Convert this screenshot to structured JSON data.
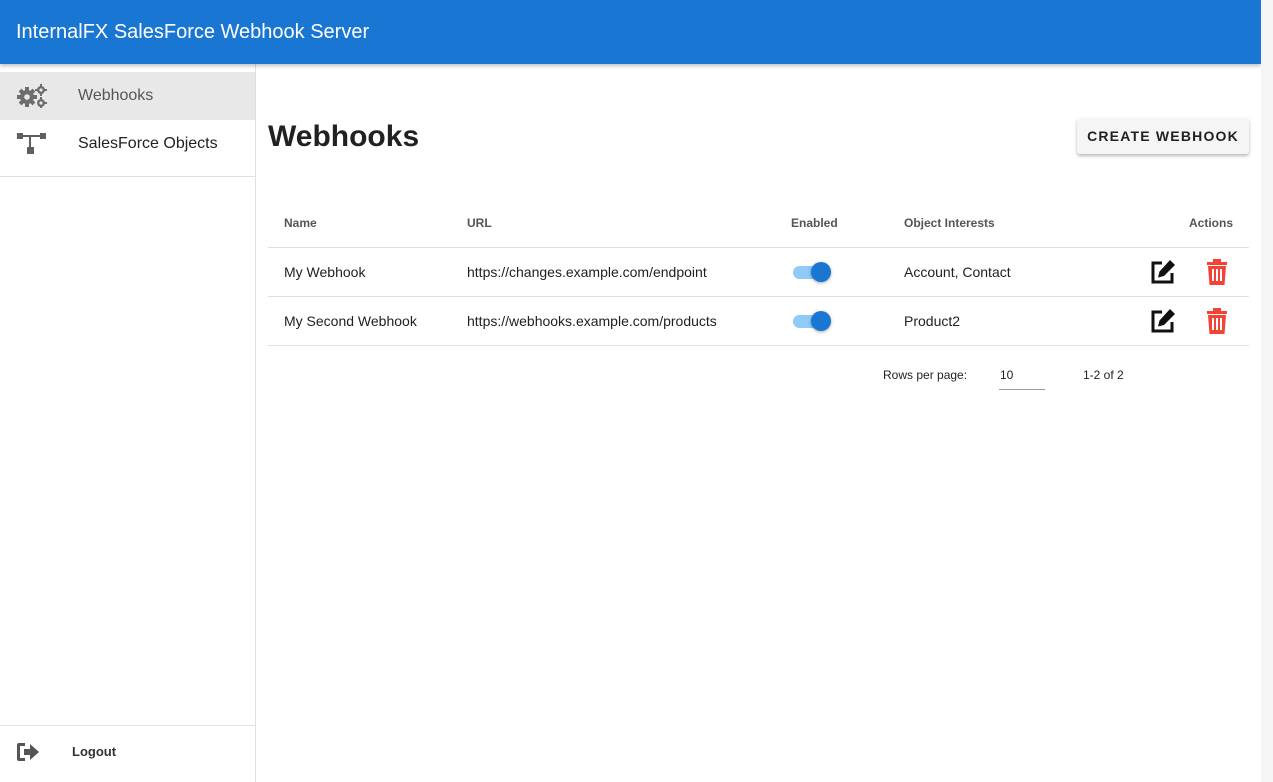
{
  "app": {
    "title": "InternalFX SalesForce Webhook Server",
    "brand_color": "#1976d2",
    "danger_color": "#f44336"
  },
  "sidebar": {
    "items": [
      {
        "label": "Webhooks",
        "icon": "gears-icon",
        "active": true
      },
      {
        "label": "SalesForce Objects",
        "icon": "sitemap-icon",
        "active": false
      }
    ],
    "logout": {
      "label": "Logout",
      "icon": "sign-out-icon"
    }
  },
  "main": {
    "title": "Webhooks",
    "create_button": "CREATE WEBHOOK"
  },
  "table": {
    "columns": [
      "Name",
      "URL",
      "Enabled",
      "Object Interests",
      "Actions"
    ],
    "rows": [
      {
        "name": "My Webhook",
        "url": "https://changes.example.com/endpoint",
        "enabled": true,
        "object_interests": "Account, Contact"
      },
      {
        "name": "My Second Webhook",
        "url": "https://webhooks.example.com/products",
        "enabled": true,
        "object_interests": "Product2"
      }
    ]
  },
  "pagination": {
    "rows_per_page_label": "Rows per page:",
    "rows_per_page": "10",
    "range": "1-2 of 2"
  }
}
